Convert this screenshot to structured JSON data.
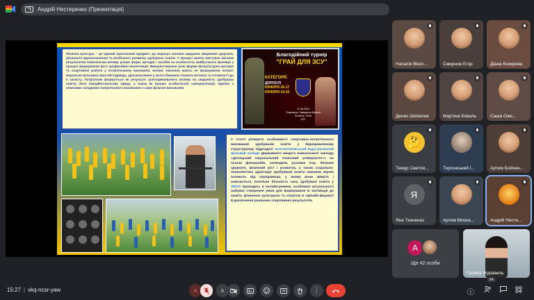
{
  "top_bar": {
    "presenter_chip": "Андрій Нестеренко (Презентація)"
  },
  "slide": {
    "text_block_1": "Фізична культура – це єдиний практичний предмет, що вирішує основні завдання зміцнення здоров'я, фізичного вдосконалення та всебічного розвитку здобувача освіти. У процесі занять виступає якісним результатом комплексом впливу різних форм, методів і засобів на особистість майбутнього фахівця у процесі формування його професійної компетенції. Використовуючи різні форми фізкультурно-масової та спортивної роботи у патріотичному вихованні, велике значення мають не формування патріот морально-вольових якостей індивіда, удосконалення у нього бажання служити вітчизні та готовності до її захисту. Патріотизм формується як результат цілеспрямованого впливу на свідомість здобувача освіти, його емоційно-вольову сферу, а також як процес особистісної самореалізації. Однією з ключових складових патріотичного виховання є саме фізичне виховання.",
    "poster": {
      "title_line1": "Благодійний турнір",
      "title_line2": "\"ГРАЙ ДЛЯ ЗСУ\"",
      "category_header": "КАТЕГОРІЇ:",
      "category_lines": [
        "ДОРОСЛІ",
        "ЮНІОРИ 16-17",
        "ЮНІОРИ 14-15"
      ],
      "date": "11.06.2023",
      "place": "Покровськ, Заводська Ворота",
      "start": "Початок: 10:00",
      "note": "ЗСУ"
    },
    "text_block_2_parts": {
      "p1": "У статті розкрито особливості спортивно-патріотичного виховання здобувачів освіти у Відокремленому структурному підрозділі",
      "highlight": "«Костянтинівський індустріальний фаховий коледж",
      "p2": "Державного вищого навчального закладу «Донецький національний технічний університет»» на основі флешмобів, челенджів, рухових ігор. Фізичне здоров'я, фізичний ріст і розвиток, а також соціально-психологічна адаптація здобувачів освіти значною мірою залежать від середовища, у якому вони живуть і навчаються. Оскільки більшість часу здобувачі освіти у",
      "highlight2": "ЗФПО",
      "p3": "проводять в онлайн-режимі, особливої актуальності набуває створення умов для формування їх мотивації до занять фізичною культурою та спортом в офлайн-форматі й досягнення реальних спортивних результатів."
    }
  },
  "participants": [
    {
      "name": "Наталія Віног...",
      "avatar": "face",
      "initial": ""
    },
    {
      "name": "Смирнов Егор",
      "avatar": "face",
      "initial": ""
    },
    {
      "name": "Діана Козирєва",
      "avatar": "face",
      "initial": ""
    },
    {
      "name": "Денис Шепелев",
      "avatar": "face",
      "initial": ""
    },
    {
      "name": "Мар'яна Коваль",
      "avatar": "face",
      "initial": ""
    },
    {
      "name": "Саша Оже...",
      "avatar": "face",
      "initial": ""
    },
    {
      "name": "Тимур Светли...",
      "avatar": "emoji",
      "initial": "🤔"
    },
    {
      "name": "Торгонський І...",
      "avatar": "photo",
      "initial": ""
    },
    {
      "name": "Артем Бойчен...",
      "avatar": "face",
      "initial": ""
    },
    {
      "name": "Яна Ткаченко",
      "avatar": "letter",
      "initial": "Я"
    },
    {
      "name": "Артем Моска...",
      "avatar": "face",
      "initial": ""
    },
    {
      "name": "Андрій Несте...",
      "avatar": "buddha",
      "initial": ""
    }
  ],
  "more_participants": {
    "initial": "A",
    "label": "Ще 42 особи"
  },
  "self_view": {
    "name": "Галина Журавель"
  },
  "bottom_bar": {
    "time": "15:27",
    "separator": "|",
    "meeting_code": "xkq-ncsr-yaw",
    "badge_count": "54"
  },
  "colors": {
    "background": "#202124",
    "control": "#3c4043",
    "leave": "#ea4335",
    "active_tile": "#8ab4f8"
  }
}
